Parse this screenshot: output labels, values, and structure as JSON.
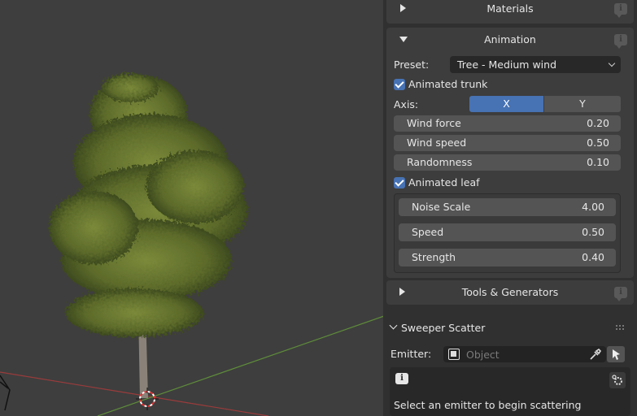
{
  "panels": {
    "materials": {
      "title": "Materials"
    },
    "animation": {
      "title": "Animation",
      "preset_label": "Preset:",
      "preset_value": "Tree - Medium wind",
      "animated_trunk_label": "Animated trunk",
      "animated_trunk_checked": true,
      "axis_label": "Axis:",
      "axis_options": [
        "X",
        "Y"
      ],
      "axis_selected": "X",
      "trunk_fields": [
        {
          "label": "Wind force",
          "value": "0.20"
        },
        {
          "label": "Wind speed",
          "value": "0.50"
        },
        {
          "label": "Randomness",
          "value": "0.10"
        }
      ],
      "animated_leaf_label": "Animated leaf",
      "animated_leaf_checked": true,
      "leaf_fields": [
        {
          "label": "Noise Scale",
          "value": "4.00"
        },
        {
          "label": "Speed",
          "value": "0.50"
        },
        {
          "label": "Strength",
          "value": "0.40"
        }
      ]
    },
    "tools": {
      "title": "Tools & Generators"
    },
    "sweeper": {
      "title": "Sweeper Scatter",
      "emitter_label": "Emitter:",
      "emitter_placeholder": "Object",
      "message": "Select an emitter to begin scattering"
    }
  },
  "colors": {
    "accent": "#4772b3",
    "panel_bg": "#303030",
    "subpanel_bg": "#3d3d3d",
    "field_bg": "#545454",
    "viewport_bg": "#3e3e3e"
  },
  "icons": {
    "info": "info-icon",
    "eyedropper": "eyedropper-icon",
    "cursor": "cursor-icon",
    "object": "object-icon",
    "gear": "gear-icon"
  }
}
